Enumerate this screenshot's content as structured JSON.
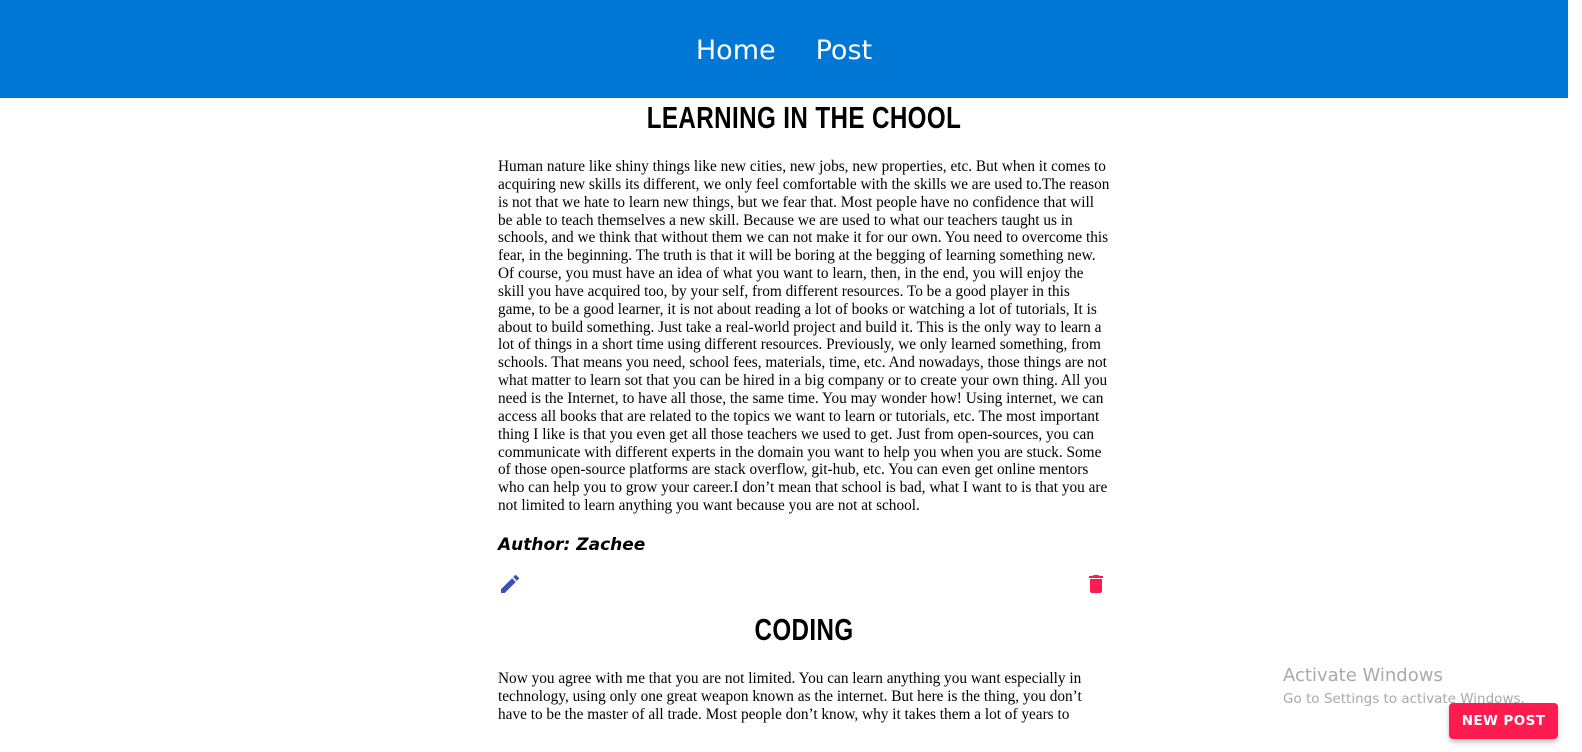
{
  "nav": {
    "home_label": "Home",
    "post_label": "Post"
  },
  "posts": [
    {
      "title": "LEARNING IN THE CHOOL",
      "body": "Human nature like shiny things like new cities, new jobs, new properties, etc. But when it comes to acquiring new skills its different, we only feel comfortable with the skills we are used to.The reason is not that we hate to learn new things, but we fear that. Most people have no confidence that will be able to teach themselves a new skill. Because we are used to what our teachers taught us in schools, and we think that without them we can not make it for our own. You need to overcome this fear, in the beginning. The truth is that it will be boring at the begging of learning something new. Of course, you must have an idea of what you want to learn, then, in the end, you will enjoy the skill you have acquired too, by your self, from different resources. To be a good player in this game, to be a good learner, it is not about reading a lot of books or watching a lot of tutorials, It is about to build something. Just take a real-world project and build it. This is the only way to learn a lot of things in a short time using different resources. Previously, we only learned something, from schools. That means you need, school fees, materials, time, etc. And nowadays, those things are not what matter to learn sot that you can be hired in a big company or to create your own thing. All you need is the Internet, to have all those, the same time. You may wonder how! Using internet, we can access all books that are related to the topics we want to learn or tutorials, etc. The most important thing I like is that you even get all those teachers we used to get. Just from open-sources, you can communicate with different experts in the domain you want to help you when you are stuck. Some of those open-source platforms are stack overflow, git-hub, etc. You can even get online mentors who can help you to grow your career.I don’t mean that school is bad, what I want to is that you are not limited to learn anything you want because you are not at school.",
      "author": "Author: Zachee"
    },
    {
      "title": "CODING",
      "body": "Now you agree with me that you are not limited. You can learn anything you want especially in technology, using only one great weapon known as the internet. But here is the thing, you don’t have to be the master of all trade. Most people don’t know, why it takes them a lot of years to"
    }
  ],
  "icons": {
    "edit": "pencil-icon",
    "delete": "trash-icon"
  },
  "colors": {
    "navbar": "#0077d4",
    "edit_icon": "#3f51b5",
    "delete_icon": "#ff1a50",
    "new_post_button": "#ff1a50"
  },
  "watermark": {
    "title": "Activate Windows",
    "subtitle": "Go to Settings to activate Windows."
  },
  "new_post_label": "NEW POST"
}
